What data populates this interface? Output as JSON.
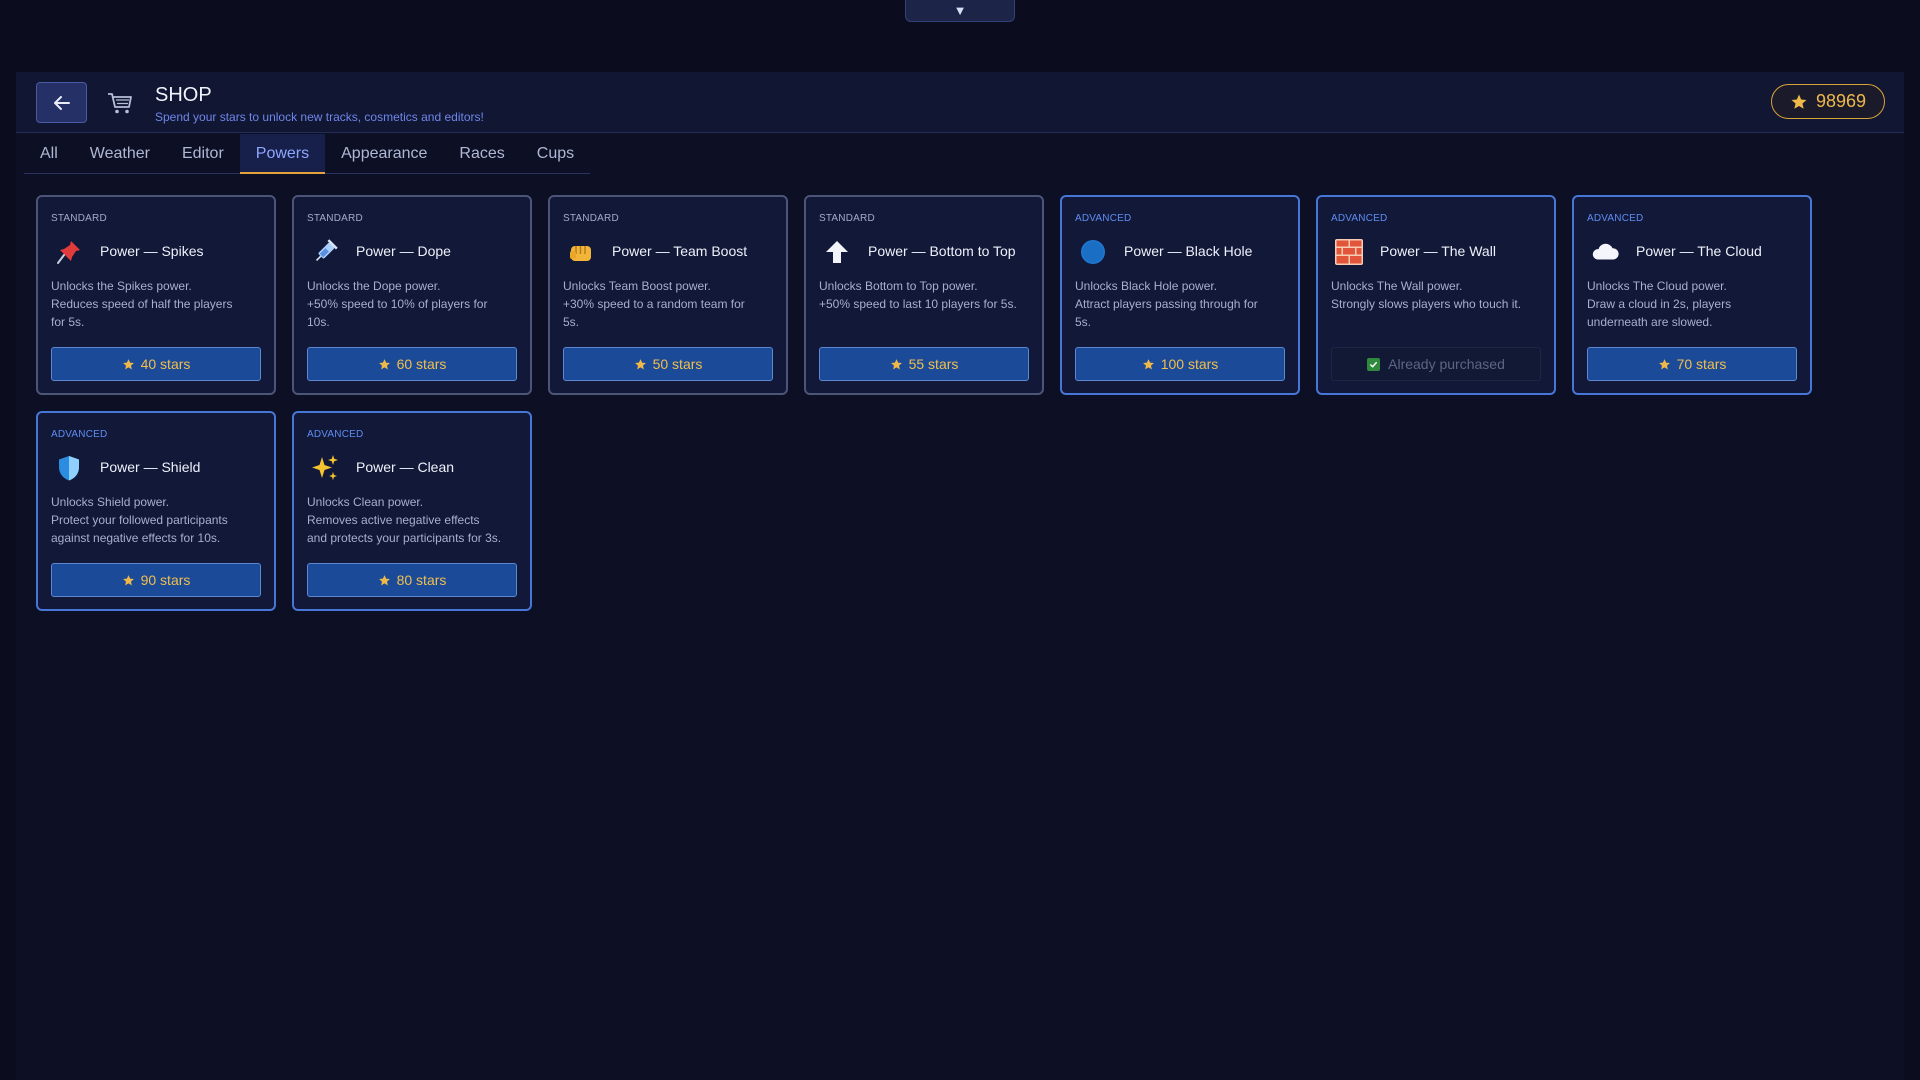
{
  "top_toggle": "▼",
  "header": {
    "title": "SHOP",
    "subtitle": "Spend your stars to unlock new tracks, cosmetics and editors!",
    "star_balance": "98969"
  },
  "tabs": [
    {
      "label": "All",
      "active": false
    },
    {
      "label": "Weather",
      "active": false
    },
    {
      "label": "Editor",
      "active": false
    },
    {
      "label": "Powers",
      "active": true
    },
    {
      "label": "Appearance",
      "active": false
    },
    {
      "label": "Races",
      "active": false
    },
    {
      "label": "Cups",
      "active": false
    }
  ],
  "items": [
    {
      "tier": "STANDARD",
      "icon": "pin-icon",
      "name": "Power — Spikes",
      "desc": [
        "Unlocks the Spikes power.",
        "Reduces speed of half the players",
        "for 5s."
      ],
      "price": "40 stars",
      "purchased": false
    },
    {
      "tier": "STANDARD",
      "icon": "syringe-icon",
      "name": "Power — Dope",
      "desc": [
        "Unlocks the Dope power.",
        "+50% speed to 10% of players for",
        "10s."
      ],
      "price": "60 stars",
      "purchased": false
    },
    {
      "tier": "STANDARD",
      "icon": "fist-icon",
      "name": "Power — Team Boost",
      "desc": [
        "Unlocks Team Boost power.",
        "+30% speed to a random team for",
        "5s."
      ],
      "price": "50 stars",
      "purchased": false
    },
    {
      "tier": "STANDARD",
      "icon": "arrow-up-icon",
      "name": "Power — Bottom to Top",
      "desc": [
        "Unlocks Bottom to Top power.",
        "+50% speed to last 10 players for 5s."
      ],
      "price": "55 stars",
      "purchased": false
    },
    {
      "tier": "ADVANCED",
      "icon": "black-hole-icon",
      "name": "Power — Black Hole",
      "desc": [
        "Unlocks Black Hole power.",
        "Attract players passing through for",
        "5s."
      ],
      "price": "100 stars",
      "purchased": false
    },
    {
      "tier": "ADVANCED",
      "icon": "brick-wall-icon",
      "name": "Power — The Wall",
      "desc": [
        "Unlocks The Wall power.",
        "Strongly slows players who touch it."
      ],
      "price": "Already purchased",
      "purchased": true
    },
    {
      "tier": "ADVANCED",
      "icon": "cloud-icon",
      "name": "Power — The Cloud",
      "desc": [
        "Unlocks The Cloud power.",
        "Draw a cloud in 2s, players",
        "underneath are slowed."
      ],
      "price": "70 stars",
      "purchased": false
    },
    {
      "tier": "ADVANCED",
      "icon": "shield-icon",
      "name": "Power — Shield",
      "desc": [
        "Unlocks Shield power.",
        "Protect your followed participants",
        "against negative effects for 10s."
      ],
      "price": "90 stars",
      "purchased": false
    },
    {
      "tier": "ADVANCED",
      "icon": "sparkles-icon",
      "name": "Power — Clean",
      "desc": [
        "Unlocks Clean power.",
        "Removes active negative effects",
        "and protects your participants for 3s."
      ],
      "price": "80 stars",
      "purchased": false
    }
  ],
  "colors": {
    "background": "#0b0d1f",
    "accent": "#6f86ea",
    "star": "#efb94a",
    "standard_border": "#4c5577",
    "advanced_border": "#4676d8",
    "buy_button": "#1b4a99"
  }
}
